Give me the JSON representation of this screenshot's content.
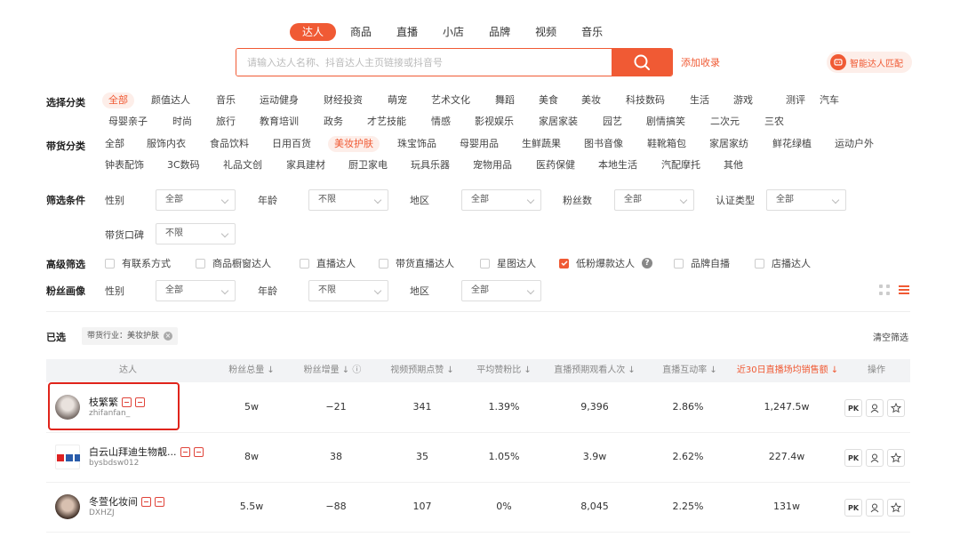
{
  "top_tabs": [
    "达人",
    "商品",
    "直播",
    "小店",
    "品牌",
    "视频",
    "音乐"
  ],
  "search": {
    "placeholder": "请输入达人名称、抖音达人主页链接或抖音号"
  },
  "add_link": "添加收录",
  "smart_button": "智能达人匹配",
  "category": {
    "label": "选择分类",
    "row1": [
      "全部",
      "颜值达人",
      "音乐",
      "运动健身",
      "财经投资",
      "萌宠",
      "艺术文化",
      "舞蹈",
      "美食",
      "美妆",
      "科技数码",
      "生活",
      "游戏",
      "测评",
      "汽车"
    ],
    "row2": [
      "母婴亲子",
      "时尚",
      "旅行",
      "教育培训",
      "政务",
      "才艺技能",
      "情感",
      "影视娱乐",
      "家居家装",
      "园艺",
      "剧情搞笑",
      "二次元",
      "三农"
    ]
  },
  "goods": {
    "label": "带货分类",
    "row1": [
      "全部",
      "服饰内衣",
      "食品饮料",
      "日用百货",
      "美妆护肤",
      "珠宝饰品",
      "母婴用品",
      "生鲜蔬果",
      "图书音像",
      "鞋靴箱包",
      "家居家纺",
      "鲜花绿植",
      "运动户外"
    ],
    "row2": [
      "钟表配饰",
      "3C数码",
      "礼品文创",
      "家具建材",
      "厨卫家电",
      "玩具乐器",
      "宠物用品",
      "医药保健",
      "本地生活",
      "汽配摩托",
      "其他"
    ]
  },
  "filter": {
    "label": "筛选条件",
    "gender": "性别",
    "gender_val": "全部",
    "age": "年龄",
    "age_val": "不限",
    "region": "地区",
    "region_val": "全部",
    "fans": "粉丝数",
    "fans_val": "全部",
    "cert": "认证类型",
    "cert_val": "全部",
    "reputation": "带货口碑",
    "reputation_val": "不限"
  },
  "advanced": {
    "label": "高级筛选",
    "options": [
      "有联系方式",
      "商品橱窗达人",
      "直播达人",
      "带货直播达人",
      "星图达人",
      "低粉爆款达人",
      "品牌自播",
      "店播达人"
    ],
    "checked_index": 5
  },
  "portrait": {
    "label": "粉丝画像",
    "gender": "性别",
    "gender_val": "全部",
    "age": "年龄",
    "age_val": "不限",
    "region": "地区",
    "region_val": "全部"
  },
  "selected": {
    "label": "已选",
    "tag": "带货行业：美妆护肤",
    "clear": "清空筛选"
  },
  "table": {
    "headers": [
      "达人",
      "粉丝总量",
      "粉丝增量",
      "视频预期点赞",
      "平均赞粉比",
      "直播预期观看人次",
      "直播互动率",
      "近30日直播场均销售额",
      "操作"
    ],
    "rows": [
      {
        "name": "枝繁繁",
        "handle": "zhifanfan_",
        "fans": "5w",
        "growth": "−21",
        "likes": "341",
        "ratio": "1.39%",
        "views": "9,396",
        "rate": "2.86%",
        "sales": "1,247.5w"
      },
      {
        "name": "白云山拜迪生物靓...",
        "handle": "bysbdsw012",
        "fans": "8w",
        "growth": "38",
        "likes": "35",
        "ratio": "1.05%",
        "views": "3.9w",
        "rate": "2.62%",
        "sales": "227.4w"
      },
      {
        "name": "冬萱化妆间",
        "handle": "DXHZJ",
        "fans": "5.5w",
        "growth": "−88",
        "likes": "107",
        "ratio": "0%",
        "views": "8,045",
        "rate": "2.25%",
        "sales": "131w"
      }
    ],
    "pk_label": "PK"
  }
}
